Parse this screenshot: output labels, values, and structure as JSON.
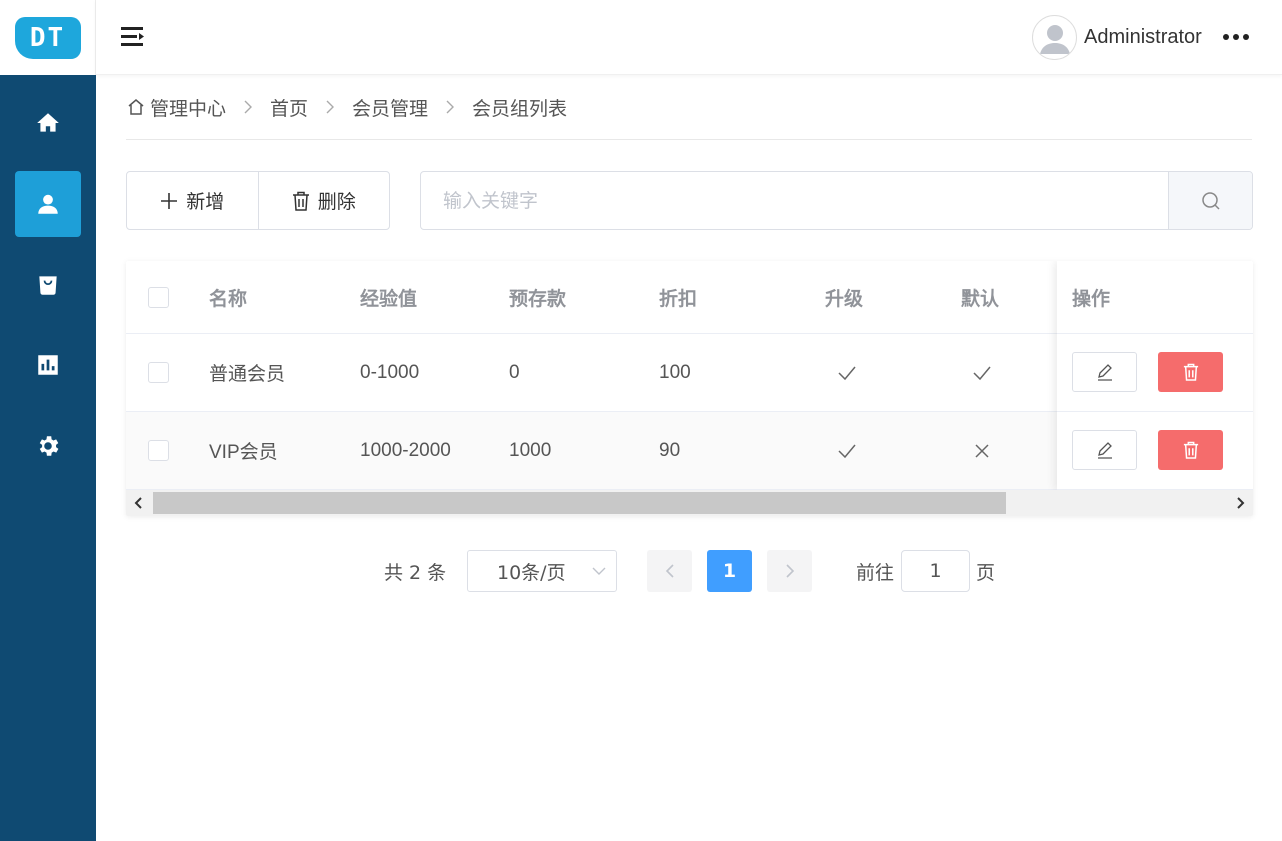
{
  "brand": {
    "logo_text": "DT"
  },
  "sidebar": {
    "items": [
      {
        "name": "home-icon"
      },
      {
        "name": "user-icon",
        "active": true
      },
      {
        "name": "shopping-bag-icon"
      },
      {
        "name": "bar-chart-icon"
      },
      {
        "name": "gear-icon"
      }
    ]
  },
  "header": {
    "username": "Administrator"
  },
  "breadcrumb": [
    "管理中心",
    "首页",
    "会员管理",
    "会员组列表"
  ],
  "toolbar": {
    "add_label": "新增",
    "delete_label": "删除"
  },
  "search": {
    "placeholder": "输入关键字",
    "value": ""
  },
  "table": {
    "columns": [
      "名称",
      "经验值",
      "预存款",
      "折扣",
      "升级",
      "默认",
      "操作"
    ],
    "rows": [
      {
        "name": "普通会员",
        "exp": "0-1000",
        "deposit": "0",
        "discount": "100",
        "upgrade": true,
        "default": true
      },
      {
        "name": "VIP会员",
        "exp": "1000-2000",
        "deposit": "1000",
        "discount": "90",
        "upgrade": true,
        "default": false
      }
    ]
  },
  "pagination": {
    "total_text": "共 2 条",
    "page_size": "10条/页",
    "current_page": "1",
    "goto_label": "前往",
    "goto_value": "1",
    "goto_unit": "页"
  }
}
